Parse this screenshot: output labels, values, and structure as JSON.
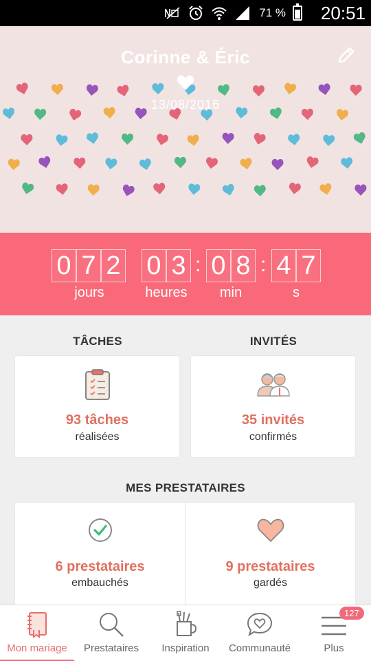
{
  "status_bar": {
    "battery": "71 %",
    "battery_level": 0.71,
    "time": "20:51",
    "icons": [
      "nfc-icon",
      "alarm-icon",
      "wifi-icon",
      "signal-icon",
      "battery-icon"
    ]
  },
  "header": {
    "couple": "Corinne & Éric",
    "date": "13/08/2016",
    "edit_icon": "pencil-icon",
    "background_color": "#f2e3e3"
  },
  "countdown": {
    "days": [
      "0",
      "7",
      "2"
    ],
    "hours": [
      "0",
      "3"
    ],
    "minutes": [
      "0",
      "8"
    ],
    "seconds": [
      "4",
      "7"
    ],
    "separator": ":",
    "labels": {
      "days": "jours",
      "hours": "heures",
      "minutes": "min",
      "seconds": "s"
    },
    "color": "#f96979"
  },
  "tasks": {
    "title": "TÂCHES",
    "value": "93 tâches",
    "sub": "réalisées",
    "icon": "clipboard-icon"
  },
  "guests": {
    "title": "INVITÉS",
    "value": "35 invités",
    "sub": "confirmés",
    "icon": "guests-icon"
  },
  "vendors": {
    "title": "MES PRESTATAIRES",
    "hired": {
      "value": "6 prestataires",
      "sub": "embauchés",
      "icon": "check-circle-icon"
    },
    "saved": {
      "value": "9 prestataires",
      "sub": "gardés",
      "icon": "heart-icon"
    }
  },
  "nav": {
    "items": [
      {
        "label": "Mon mariage",
        "icon": "notebook-icon",
        "active": true
      },
      {
        "label": "Prestataires",
        "icon": "search-icon",
        "active": false
      },
      {
        "label": "Inspiration",
        "icon": "tools-cup-icon",
        "active": false
      },
      {
        "label": "Communauté",
        "icon": "chat-heart-icon",
        "active": false
      },
      {
        "label": "Plus",
        "icon": "menu-icon",
        "active": false,
        "badge": "127"
      }
    ],
    "accent": "#f26a7a"
  }
}
